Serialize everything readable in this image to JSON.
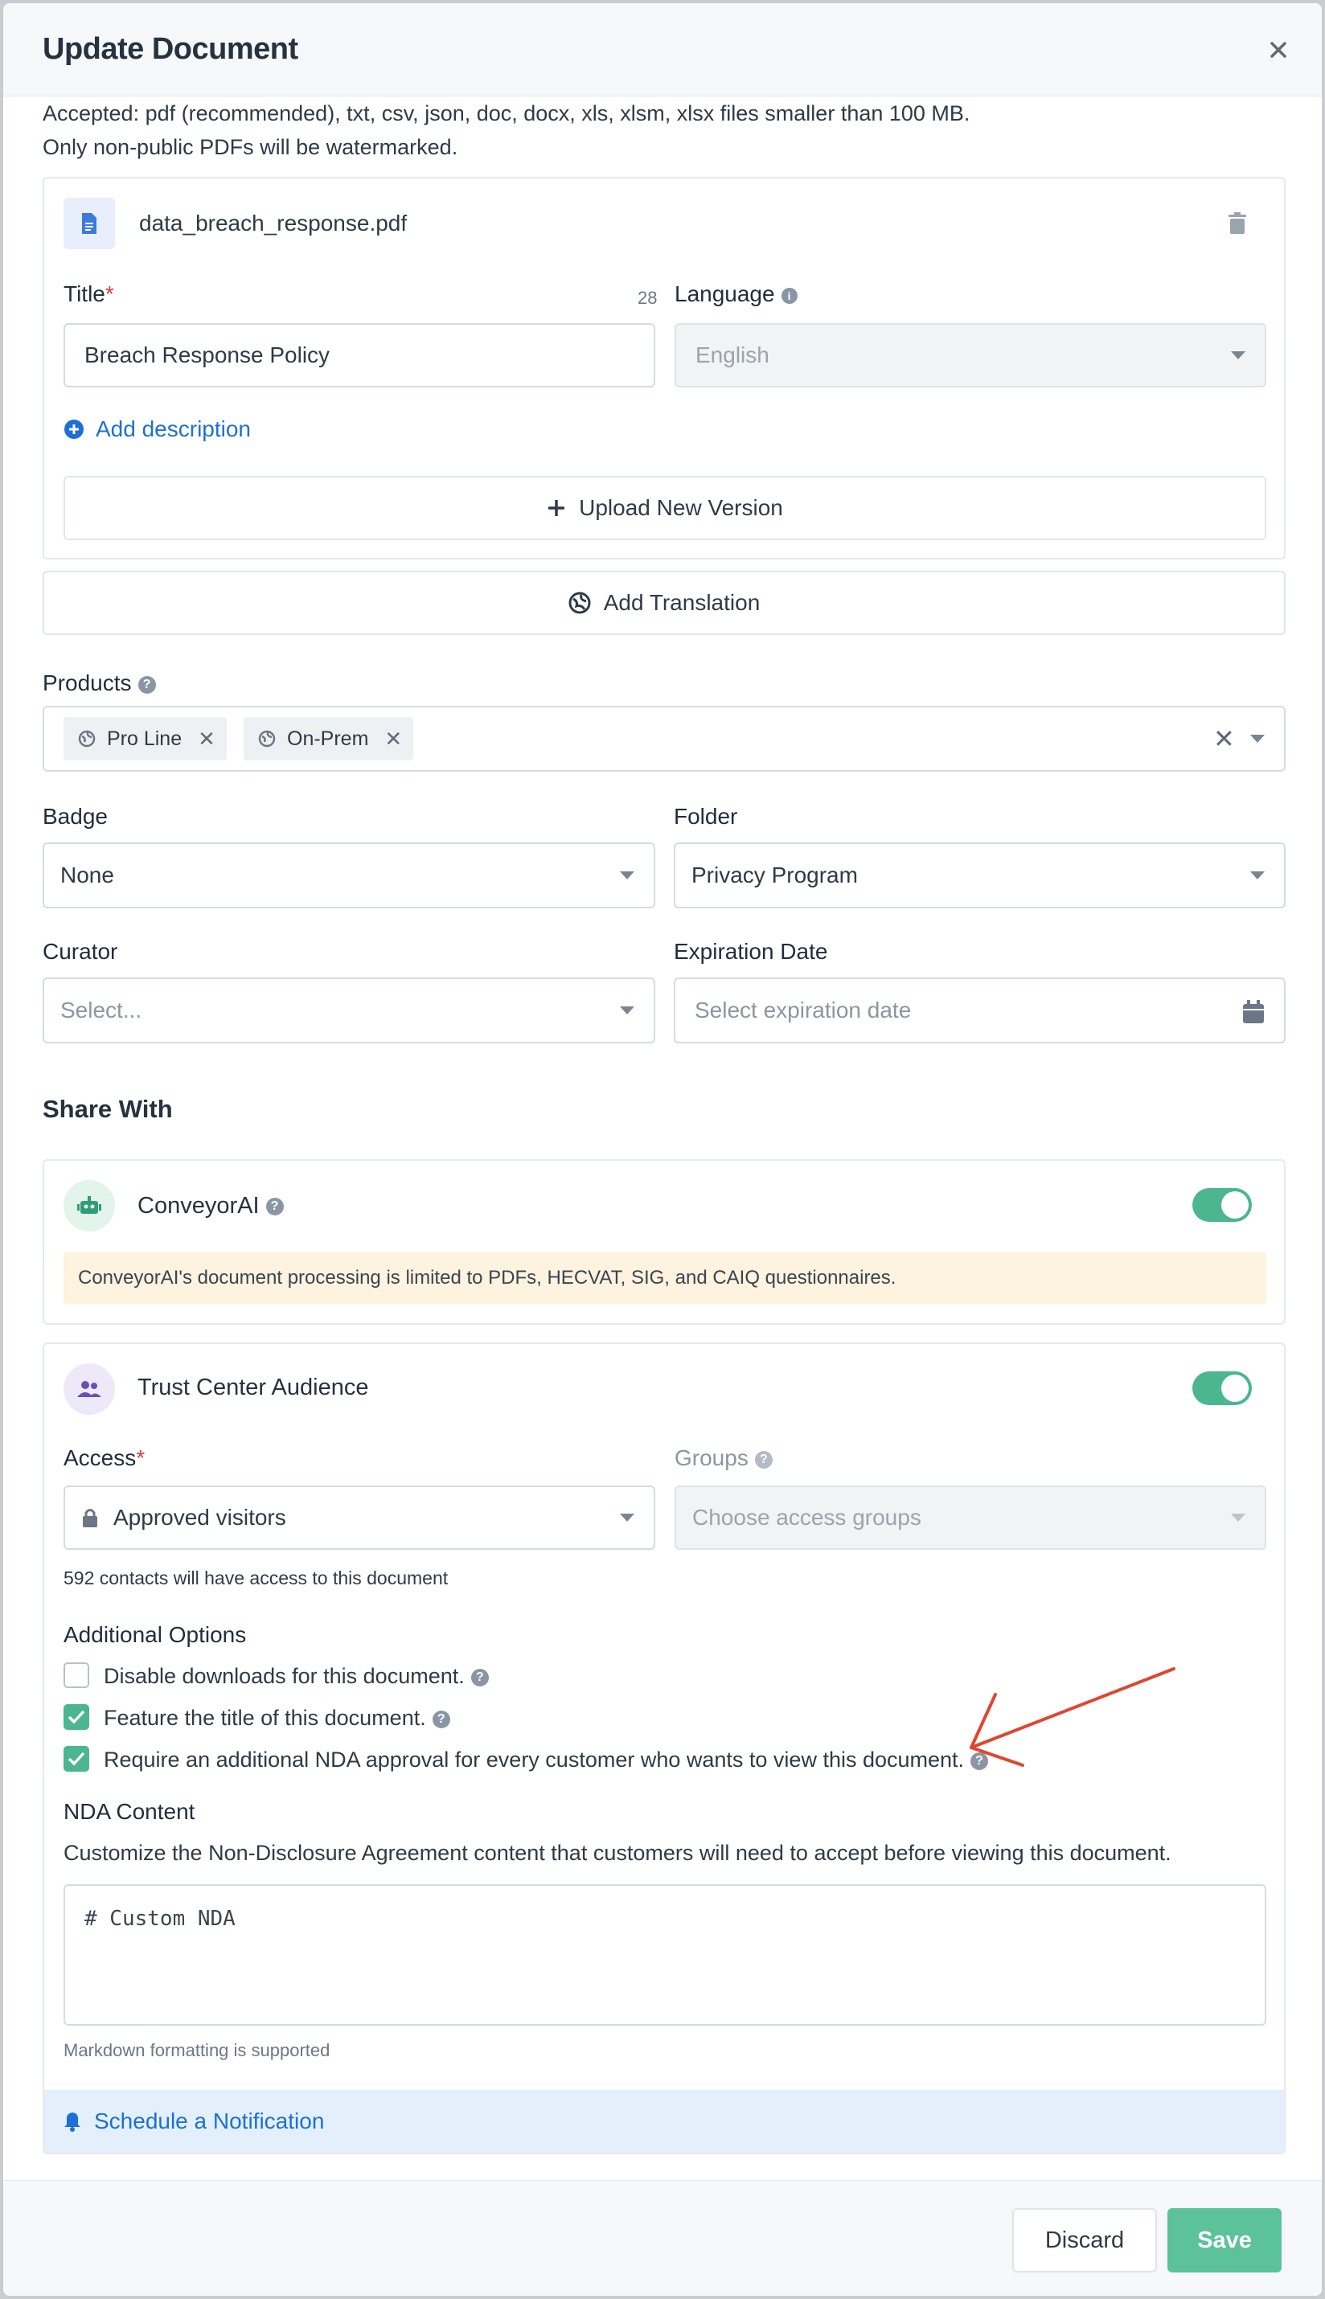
{
  "modal": {
    "title": "Update Document"
  },
  "notes": {
    "accepted": "Accepted: pdf (recommended), txt, csv, json, doc, docx, xls, xlsm, xlsx files smaller than 100 MB.",
    "watermark": "Only non-public PDFs will be watermarked."
  },
  "file": {
    "name": "data_breach_response.pdf",
    "title_label": "Title",
    "title_required": "*",
    "title_count": "28",
    "title_value": "Breach Response Policy",
    "language_label": "Language",
    "language_value": "English",
    "add_description": "Add description",
    "upload_new_version": "Upload New Version"
  },
  "add_translation": "Add Translation",
  "products": {
    "label": "Products",
    "chips": [
      "Pro Line",
      "On-Prem"
    ]
  },
  "badge": {
    "label": "Badge",
    "value": "None"
  },
  "folder": {
    "label": "Folder",
    "value": "Privacy Program"
  },
  "curator": {
    "label": "Curator",
    "placeholder": "Select..."
  },
  "expiration": {
    "label": "Expiration Date",
    "placeholder": "Select expiration date"
  },
  "share": {
    "heading": "Share With",
    "conveyor": {
      "name": "ConveyorAI",
      "notice": "ConveyorAI's document processing is limited to PDFs, HECVAT, SIG, and CAIQ questionnaires.",
      "enabled": true
    },
    "trust_center": {
      "name": "Trust Center Audience",
      "enabled": true,
      "access_label": "Access",
      "access_required": "*",
      "access_value": "Approved visitors",
      "groups_label": "Groups",
      "groups_placeholder": "Choose access groups",
      "contacts_note": "592 contacts will have access to this document",
      "additional_options": "Additional Options",
      "options": [
        {
          "label": "Disable downloads for this document.",
          "checked": false
        },
        {
          "label": "Feature the title of this document.",
          "checked": true
        },
        {
          "label": "Require an additional NDA approval for every customer who wants to view this document.",
          "checked": true
        }
      ],
      "nda_heading": "NDA Content",
      "nda_description": "Customize the Non-Disclosure Agreement content that customers will need to accept before viewing this document.",
      "nda_value": "# Custom NDA",
      "nda_hint": "Markdown formatting is supported",
      "schedule": "Schedule a Notification"
    }
  },
  "footer": {
    "discard": "Discard",
    "save": "Save"
  },
  "colors": {
    "accent": "#4bb68f",
    "link": "#1e6fd6",
    "annotation": "#e0462f"
  }
}
